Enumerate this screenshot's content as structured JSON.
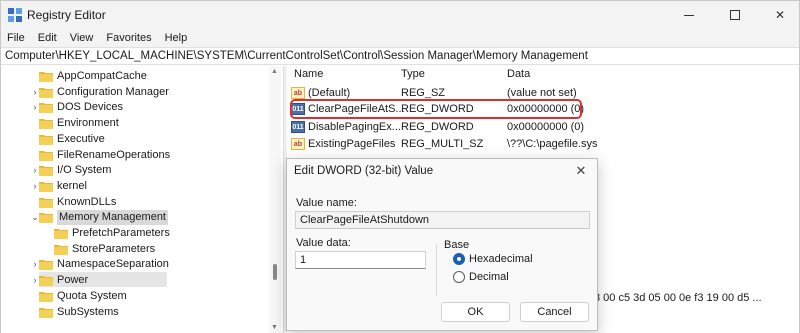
{
  "window": {
    "title": "Registry Editor",
    "icon": "registry-editor-icon"
  },
  "menu": [
    "File",
    "Edit",
    "View",
    "Favorites",
    "Help"
  ],
  "address": "Computer\\HKEY_LOCAL_MACHINE\\SYSTEM\\CurrentControlSet\\Control\\Session Manager\\Memory Management",
  "tree": {
    "items": [
      {
        "label": "AppCompatCache",
        "expander": ""
      },
      {
        "label": "Configuration Manager",
        "expander": "›"
      },
      {
        "label": "DOS Devices",
        "expander": "›"
      },
      {
        "label": "Environment",
        "expander": ""
      },
      {
        "label": "Executive",
        "expander": ""
      },
      {
        "label": "FileRenameOperations",
        "expander": ""
      },
      {
        "label": "I/O System",
        "expander": "›"
      },
      {
        "label": "kernel",
        "expander": "›"
      },
      {
        "label": "KnownDLLs",
        "expander": ""
      },
      {
        "label": "Memory Management",
        "expander": "⌄"
      },
      {
        "label": "PrefetchParameters",
        "expander": ""
      },
      {
        "label": "StoreParameters",
        "expander": ""
      },
      {
        "label": "NamespaceSeparation",
        "expander": "›"
      },
      {
        "label": "Power",
        "expander": "›"
      },
      {
        "label": "Quota System",
        "expander": ""
      },
      {
        "label": "SubSystems",
        "expander": ""
      }
    ],
    "selected": "Memory Management"
  },
  "values": {
    "columns": {
      "name": "Name",
      "type": "Type",
      "data": "Data"
    },
    "rows": [
      {
        "icon": "string-value-icon",
        "icon_text": "ab",
        "name": "(Default)",
        "type": "REG_SZ",
        "data": "(value not set)"
      },
      {
        "icon": "dword-value-icon",
        "icon_text": "011",
        "name": "ClearPageFileAtS...",
        "type": "REG_DWORD",
        "data": "0x00000000 (0)"
      },
      {
        "icon": "dword-value-icon",
        "icon_text": "011",
        "name": "DisablePagingEx...",
        "type": "REG_DWORD",
        "data": "0x00000000 (0)"
      },
      {
        "icon": "string-value-icon",
        "icon_text": "ab",
        "name": "ExistingPageFiles",
        "type": "REG_MULTI_SZ",
        "data": "\\??\\C:\\pagefile.sys"
      }
    ],
    "partial_hex": "3 00 c5 3d 05 00 0e f3 19 00 d5 ..."
  },
  "dialog": {
    "title": "Edit DWORD (32-bit) Value",
    "value_name_label": "Value name:",
    "value_name": "ClearPageFileAtShutdown",
    "value_data_label": "Value data:",
    "value_data": "1",
    "base_label": "Base",
    "radios": [
      {
        "label": "Hexadecimal",
        "checked": true
      },
      {
        "label": "Decimal",
        "checked": false
      }
    ],
    "ok_label": "OK",
    "cancel_label": "Cancel"
  },
  "colors": {
    "highlight_border": "#d93030",
    "radio_checked": "#1a5fb4"
  }
}
